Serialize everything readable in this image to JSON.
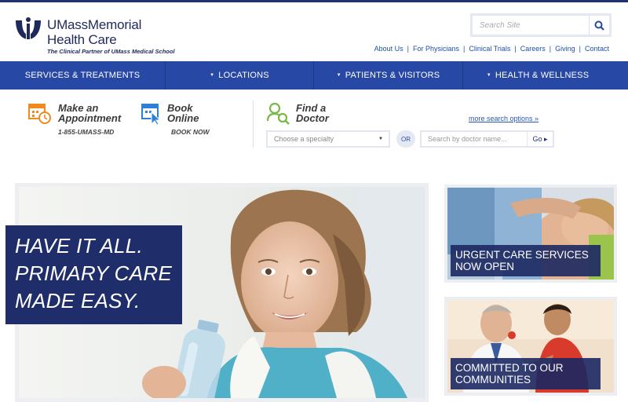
{
  "brand": {
    "name_line1": "UMassMemorial",
    "name_line2": "Health Care",
    "tagline": "The Clinical Partner of UMass Medical School",
    "color": "#1f2a5c"
  },
  "search": {
    "placeholder": "Search Site",
    "icon": "magnifier-icon"
  },
  "utility_links": [
    "About Us",
    "For Physicians",
    "Clinical Trials",
    "Careers",
    "Giving",
    "Contact"
  ],
  "nav": {
    "color": "#2748a4",
    "items": [
      {
        "label": "SERVICES & TREATMENTS",
        "dropdown": false
      },
      {
        "label": "LOCATIONS",
        "dropdown": true
      },
      {
        "label": "PATIENTS & VISITORS",
        "dropdown": true
      },
      {
        "label": "HEALTH & WELLNESS",
        "dropdown": true
      }
    ]
  },
  "quick_actions": {
    "appointment": {
      "line1": "Make an",
      "line2": "Appointment",
      "phone": "1-855-UMASS-MD",
      "icon": "calendar-clock-icon"
    },
    "book_online": {
      "line1": "Book",
      "line2": "Online",
      "cta": "BOOK NOW",
      "icon": "calendar-cursor-icon"
    },
    "find_doctor": {
      "line1": "Find a",
      "line2": "Doctor",
      "icon": "doctor-search-icon"
    }
  },
  "doctor_search": {
    "more_options": "more search options »",
    "specialty_placeholder": "Choose a specialty",
    "or_label": "OR",
    "name_placeholder": "Search by doctor name...",
    "go_label": "Go ▸"
  },
  "hero": {
    "lines": [
      "HAVE IT ALL.",
      "PRIMARY CARE",
      "MADE EASY."
    ]
  },
  "promos": [
    {
      "line1": "URGENT CARE SERVICES",
      "line2": "NOW OPEN"
    },
    {
      "line1": "COMMITTED TO OUR",
      "line2": "COMMUNITIES"
    }
  ],
  "accent_orange": "#f08a1c",
  "accent_blue": "#2f7fd8",
  "accent_green": "#79b94a"
}
